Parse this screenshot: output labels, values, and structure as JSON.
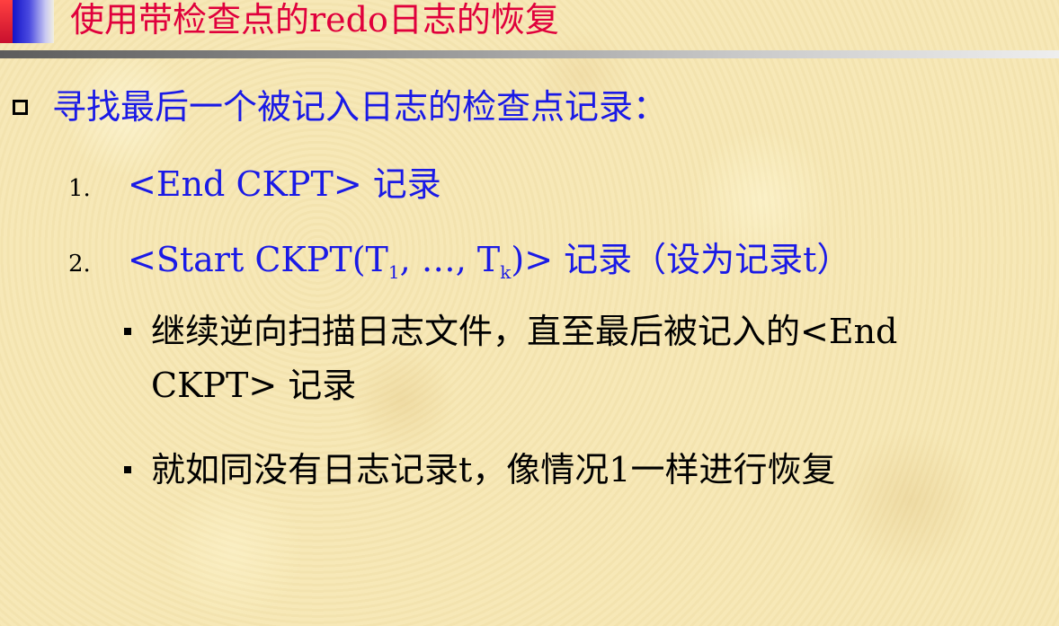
{
  "slide": {
    "title": "使用带检查点的redo日志的恢复",
    "main_point": "寻找最后一个被记入日志的检查点记录：",
    "items": [
      {
        "number": "1.",
        "text": "<End CKPT> 记录"
      },
      {
        "number": "2.",
        "text_before": "<Start CKPT(T",
        "sub_1": "1",
        "text_middle": ", …, T",
        "sub_k": "k",
        "text_after": ")> 记录（设为记录t）"
      }
    ],
    "sub_bullets": [
      "继续逆向扫描日志文件，直至最后被记入的<End CKPT> 记录",
      "就如同没有日志记录t，像情况1一样进行恢复"
    ],
    "colors": {
      "title": "#e0003c",
      "emphasis": "#1a1ae6",
      "body": "#000000",
      "background": "#f6e7b4"
    }
  }
}
